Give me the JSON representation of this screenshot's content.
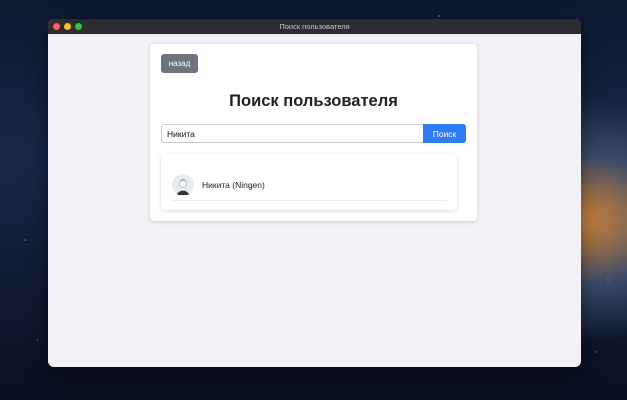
{
  "window": {
    "title": "Поиск пользователя"
  },
  "page": {
    "back_label": "назад",
    "heading": "Поиск пользователя"
  },
  "search": {
    "value": "Никита",
    "button_label": "Поиск"
  },
  "results": [
    {
      "name": "Никита (Ningen)",
      "avatar_icon": "user-avatar"
    }
  ],
  "colors": {
    "back_button": "#6c757d",
    "search_button": "#2f7cf6",
    "titlebar": "#2d2d2f",
    "window_bg": "#f2f2f6"
  }
}
